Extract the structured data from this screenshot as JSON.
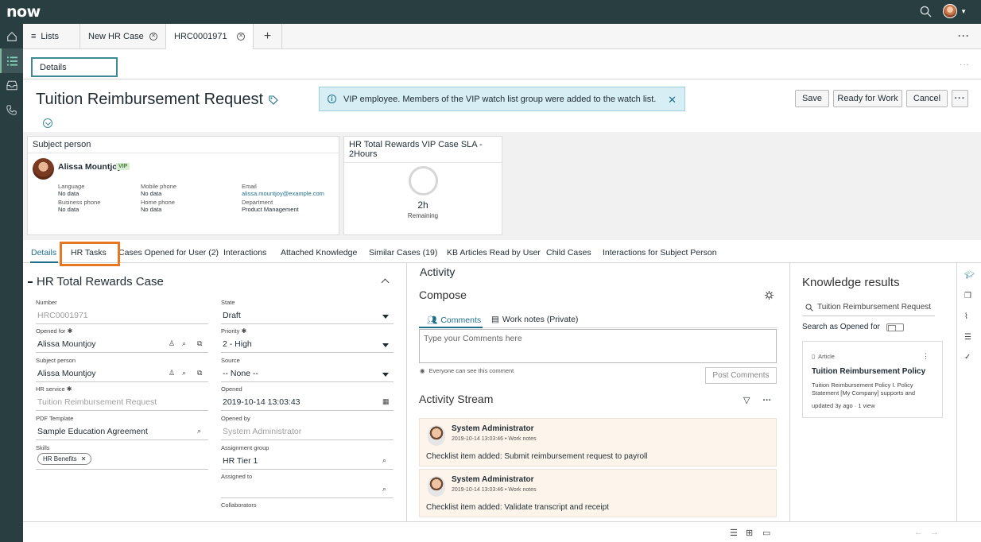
{
  "app": {
    "logo": "now"
  },
  "window_tabs": [
    {
      "label": "Lists"
    },
    {
      "label": "New HR Case"
    },
    {
      "label": "HRC0001971"
    }
  ],
  "subnav": {
    "label": "Details"
  },
  "record": {
    "title": "Tuition Reimbursement Request"
  },
  "banner": {
    "text": "VIP employee. Members of the VIP watch list group were added to the watch list."
  },
  "actions": {
    "save": "Save",
    "ready": "Ready for Work",
    "cancel": "Cancel"
  },
  "subject_card": {
    "header": "Subject person",
    "name": "Alissa Mountjoy",
    "badge": "VIP",
    "fields": [
      {
        "label": "Language",
        "value": "No data"
      },
      {
        "label": "Mobile phone",
        "value": "No data"
      },
      {
        "label": "Email",
        "value": "alissa.mountjoy@example.com"
      },
      {
        "label": "Business phone",
        "value": "No data"
      },
      {
        "label": "Home phone",
        "value": "No data"
      },
      {
        "label": "Department",
        "value": "Product Management"
      }
    ]
  },
  "sla_card": {
    "header": "HR Total Rewards VIP Case SLA - 2Hours",
    "time": "2h",
    "remaining": "Remaining"
  },
  "related_tabs": [
    {
      "label": "Details"
    },
    {
      "label": "HR Tasks"
    },
    {
      "label": "Cases Opened for User (2)"
    },
    {
      "label": "Interactions"
    },
    {
      "label": "Attached Knowledge"
    },
    {
      "label": "Similar Cases (19)"
    },
    {
      "label": "KB Articles Read by User"
    },
    {
      "label": "Child Cases"
    },
    {
      "label": "Interactions for Subject Person"
    }
  ],
  "form": {
    "section_title": "HR Total Rewards Case",
    "number": {
      "label": "Number",
      "value": "HRC0001971"
    },
    "opened_for": {
      "label": "Opened for",
      "value": "Alissa Mountjoy"
    },
    "subject_person": {
      "label": "Subject person",
      "value": "Alissa Mountjoy"
    },
    "hr_service": {
      "label": "HR service",
      "value": "Tuition Reimbursement Request"
    },
    "pdf_template": {
      "label": "PDF Template",
      "value": "Sample Education Agreement"
    },
    "skills": {
      "label": "Skills",
      "chip": "HR Benefits"
    },
    "state": {
      "label": "State",
      "value": "Draft"
    },
    "priority": {
      "label": "Priority",
      "value": "2 - High"
    },
    "source": {
      "label": "Source",
      "value": "-- None --"
    },
    "opened": {
      "label": "Opened",
      "value": "2019-10-14 13:03:43"
    },
    "opened_by": {
      "label": "Opened by",
      "value": "System Administrator"
    },
    "assignment_group": {
      "label": "Assignment group",
      "value": "HR Tier 1"
    },
    "assigned_to": {
      "label": "Assigned to",
      "value": ""
    },
    "collaborators": {
      "label": "Collaborators"
    }
  },
  "activity": {
    "title": "Activity",
    "compose": "Compose",
    "tab_comments": "Comments",
    "tab_worknotes": "Work notes (Private)",
    "placeholder": "Type your Comments here",
    "everyone": "Everyone can see this comment",
    "post": "Post Comments",
    "stream_title": "Activity Stream",
    "entries": [
      {
        "author": "System Administrator",
        "meta": "2019-10-14 13:03:46 • Work notes",
        "text": "Checklist item added: Submit reimbursement request to payroll"
      },
      {
        "author": "System Administrator",
        "meta": "2019-10-14 13:03:46 • Work notes",
        "text": "Checklist item added: Validate transcript and receipt"
      }
    ]
  },
  "knowledge": {
    "title": "Knowledge results",
    "search": "Tuition Reimbursement Request",
    "toggle_label": "Search as Opened for",
    "card": {
      "type": "Article",
      "title": "Tuition Reimbursement Policy",
      "snippet": "Tuition Reimbursement Policy I. Policy Statement [My Company] supports and",
      "meta": "updated 3y ago · 1 view"
    }
  },
  "colors": {
    "header": "#293e40",
    "accent": "#1f6f8b",
    "highlight": "#e87722"
  }
}
